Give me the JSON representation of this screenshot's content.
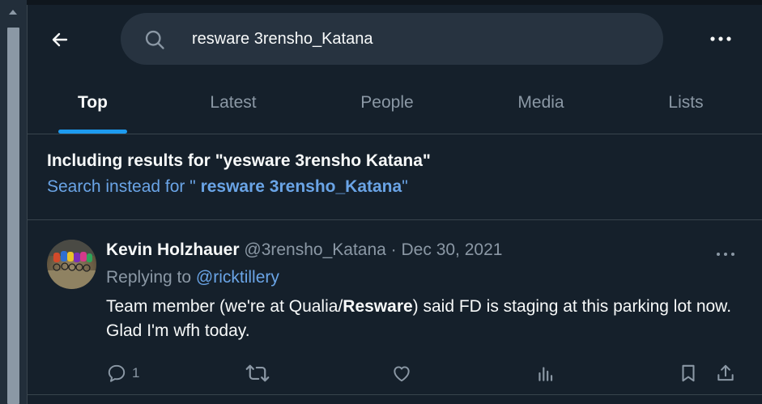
{
  "header": {
    "back_icon": "arrow-left-icon",
    "search_value": "resware 3rensho_Katana",
    "search_icon": "search-icon",
    "more_icon": "more-horizontal-icon"
  },
  "tabs": [
    {
      "label": "Top",
      "active": true
    },
    {
      "label": "Latest",
      "active": false
    },
    {
      "label": "People",
      "active": false
    },
    {
      "label": "Media",
      "active": false
    },
    {
      "label": "Lists",
      "active": false
    }
  ],
  "correction": {
    "including_prefix": "Including results for ",
    "including_query": "\"yesware 3rensho Katana\"",
    "instead_prefix": "Search instead for \" ",
    "instead_query": "resware 3rensho_Katana",
    "instead_suffix": "\""
  },
  "tweet": {
    "author_name": "Kevin Holzhauer",
    "handle": "@3rensho_Katana",
    "separator": " · ",
    "date": "Dec 30, 2021",
    "replying_prefix": "Replying to ",
    "replying_to": "@ricktillery",
    "text_before": "Team member (we're at Qualia/",
    "text_bold": "Resware",
    "text_after": ") said FD is staging at this parking lot now. Glad I'm wfh today.",
    "reply_count": "1",
    "actions": [
      "reply-icon",
      "retweet-icon",
      "like-icon",
      "views-icon",
      "bookmark-icon",
      "share-icon"
    ]
  },
  "colors": {
    "background": "#15202b",
    "accent": "#1d9bf0",
    "link": "#6aa4e6",
    "muted": "#8b98a5",
    "border": "#38444d"
  }
}
